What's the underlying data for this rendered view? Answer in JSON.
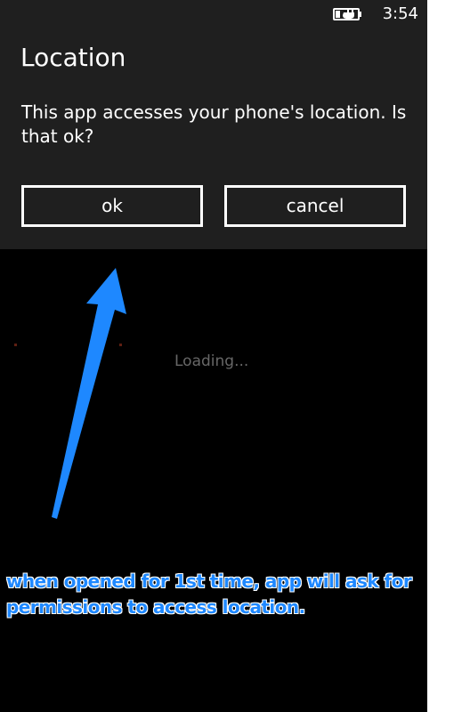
{
  "status_bar": {
    "time": "3:54",
    "battery_icon": "battery-charging-icon"
  },
  "dialog": {
    "title": "Location",
    "message": "This app accesses your phone's location. Is that ok?",
    "ok_label": "ok",
    "cancel_label": "cancel"
  },
  "background": {
    "loading_text": "Loading..."
  },
  "annotation": {
    "line_1": "when  opened for 1st time, app will ask for",
    "line_2": "permissions to access location.",
    "arrow_icon": "arrow-up-icon",
    "color": "#1e88ff"
  },
  "colors": {
    "dialog_background": "#1f1f1f",
    "screen_background": "#000000",
    "button_border": "#ffffff"
  }
}
